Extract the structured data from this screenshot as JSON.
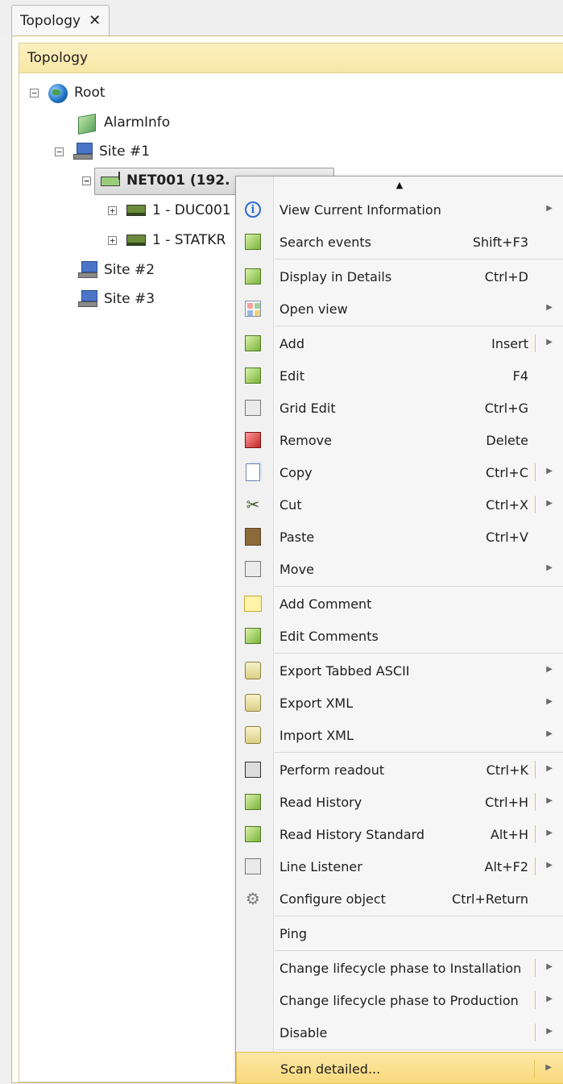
{
  "tab": {
    "label": "Topology",
    "close": "✕"
  },
  "panel": {
    "header": "Topology"
  },
  "tree": {
    "root": "Root",
    "alarminfo": "AlarmInfo",
    "site1": "Site #1",
    "net001": "NET001 (192.",
    "duc": "1 - DUC001",
    "statkr": "1 - STATKR",
    "site2": "Site #2",
    "site3": "Site #3",
    "expander_minus": "−",
    "expander_plus": "+"
  },
  "menu": {
    "scroll_up": "▲",
    "submenu_arrow": "▶",
    "items": [
      {
        "label": "View Current Information",
        "shortcut": ""
      },
      {
        "label": "Search events",
        "shortcut": "Shift+F3"
      },
      {
        "label": "Display in Details",
        "shortcut": "Ctrl+D"
      },
      {
        "label": "Open view",
        "shortcut": ""
      },
      {
        "label": "Add",
        "shortcut": "Insert"
      },
      {
        "label": "Edit",
        "shortcut": "F4"
      },
      {
        "label": "Grid Edit",
        "shortcut": "Ctrl+G"
      },
      {
        "label": "Remove",
        "shortcut": "Delete"
      },
      {
        "label": "Copy",
        "shortcut": "Ctrl+C"
      },
      {
        "label": "Cut",
        "shortcut": "Ctrl+X"
      },
      {
        "label": "Paste",
        "shortcut": "Ctrl+V"
      },
      {
        "label": "Move",
        "shortcut": ""
      },
      {
        "label": "Add Comment",
        "shortcut": ""
      },
      {
        "label": "Edit Comments",
        "shortcut": ""
      },
      {
        "label": "Export Tabbed ASCII",
        "shortcut": ""
      },
      {
        "label": "Export XML",
        "shortcut": ""
      },
      {
        "label": "Import XML",
        "shortcut": ""
      },
      {
        "label": "Perform readout",
        "shortcut": "Ctrl+K"
      },
      {
        "label": "Read History",
        "shortcut": "Ctrl+H"
      },
      {
        "label": "Read History Standard",
        "shortcut": "Alt+H"
      },
      {
        "label": "Line Listener",
        "shortcut": "Alt+F2"
      },
      {
        "label": "Configure object",
        "shortcut": "Ctrl+Return"
      },
      {
        "label": "Ping",
        "shortcut": ""
      },
      {
        "label": "Change lifecycle phase to Installation",
        "shortcut": ""
      },
      {
        "label": "Change lifecycle phase to Production",
        "shortcut": ""
      },
      {
        "label": "Disable",
        "shortcut": ""
      },
      {
        "label": "Scan detailed...",
        "shortcut": ""
      }
    ]
  }
}
